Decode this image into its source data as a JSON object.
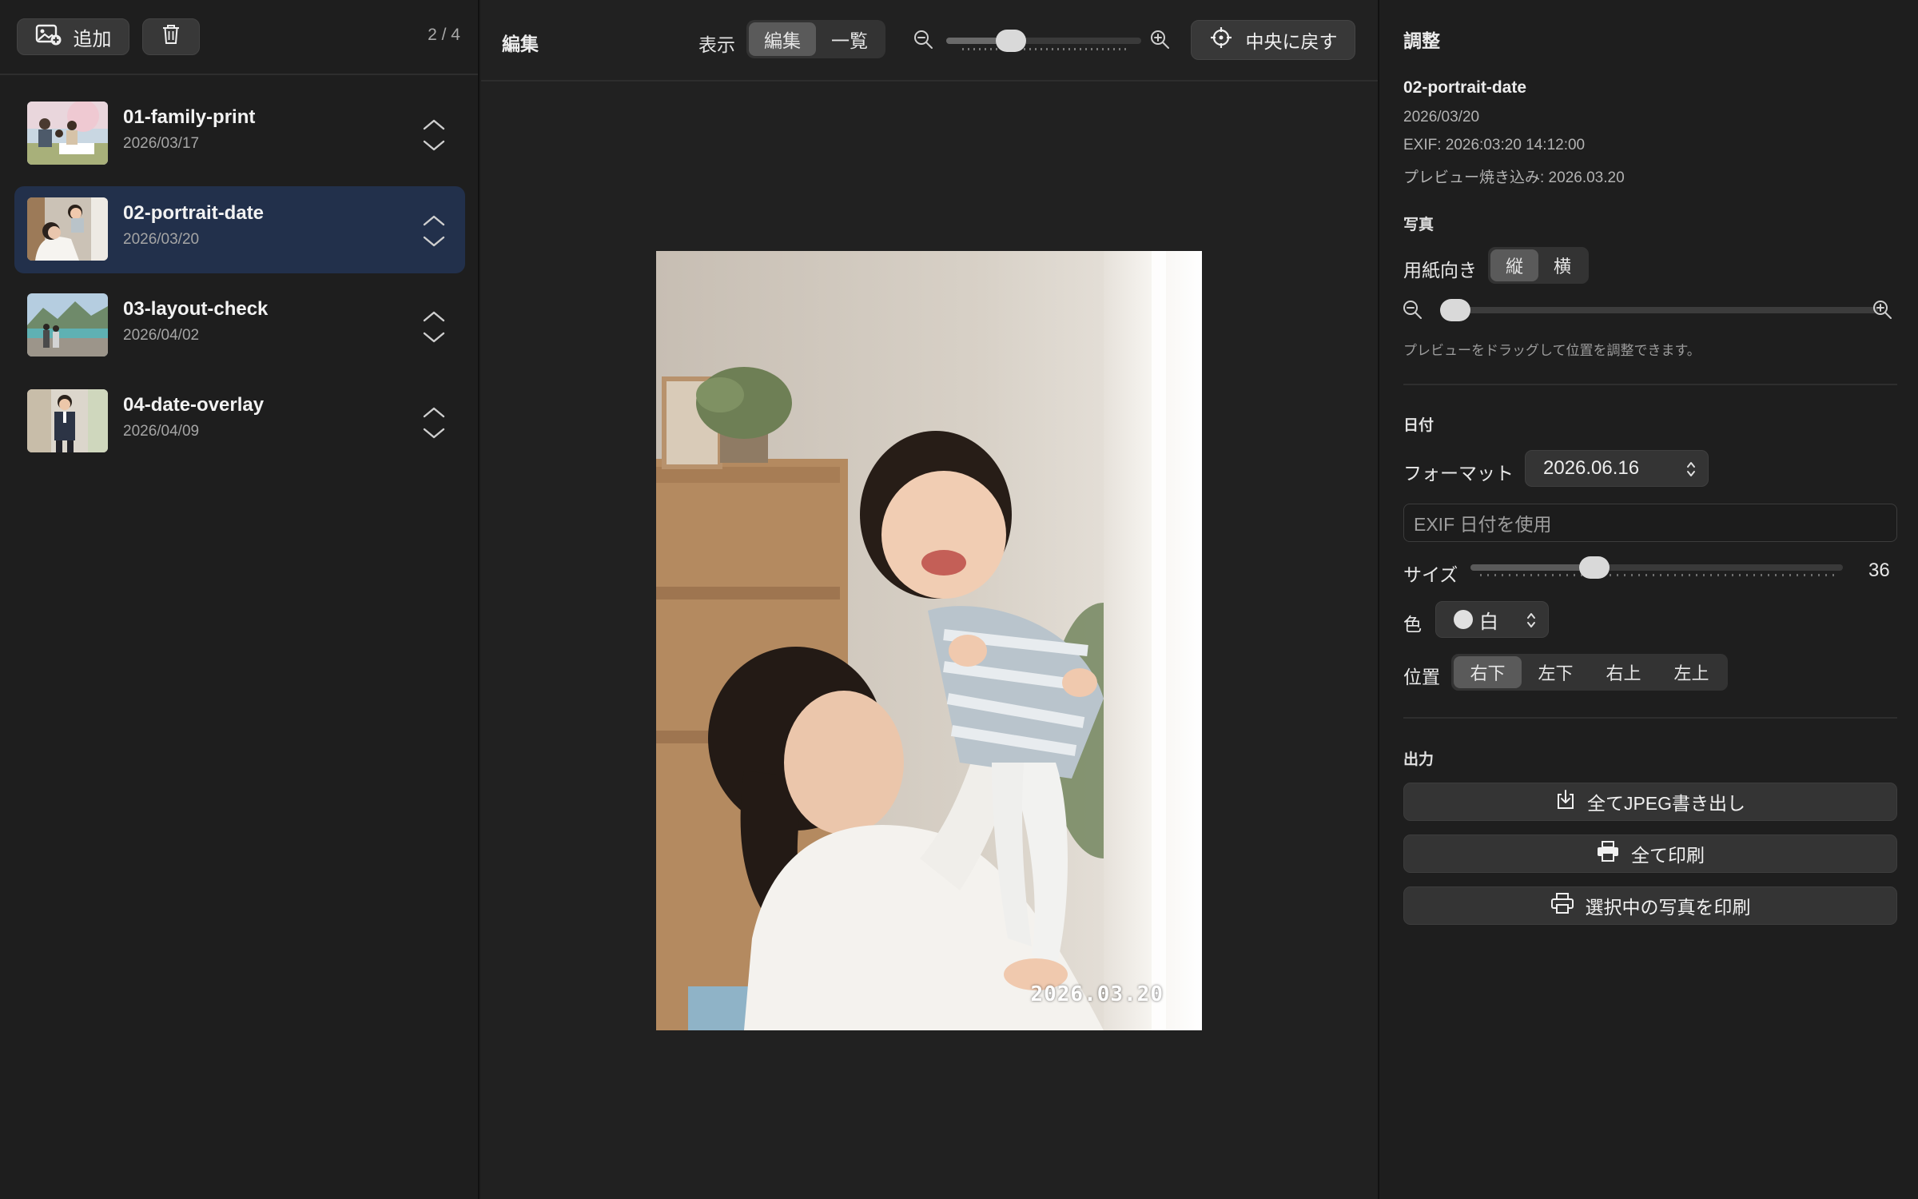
{
  "sidebar": {
    "add_label": "追加",
    "count": "2 / 4",
    "items": [
      {
        "name": "01-family-print",
        "date": "2026/03/17"
      },
      {
        "name": "02-portrait-date",
        "date": "2026/03/20"
      },
      {
        "name": "03-layout-check",
        "date": "2026/04/02"
      },
      {
        "name": "04-date-overlay",
        "date": "2026/04/09"
      }
    ]
  },
  "center": {
    "title": "編集",
    "view_label": "表示",
    "view_options": [
      "編集",
      "一覧"
    ],
    "view_selected": "編集",
    "zoom_level": 0.3,
    "recenter_label": "中央に戻す",
    "date_stamp": "2026.03.20"
  },
  "panel": {
    "title": "調整",
    "file_name": "02-portrait-date",
    "date": "2026/03/20",
    "exif": "EXIF: 2026:03:20 14:12:00",
    "preview_burn": "プレビュー焼き込み: 2026.03.20",
    "photo_section": "写真",
    "orientation_label": "用紙向き",
    "orientation_options": [
      "縦",
      "横"
    ],
    "orientation_selected": "縦",
    "photo_zoom": 0.0,
    "drag_hint": "プレビューをドラッグして位置を調整できます。",
    "date_section": "日付",
    "format_label": "フォーマット",
    "format_value": "2026.06.16",
    "exif_placeholder": "EXIF 日付を使用",
    "size_label": "サイズ",
    "size_value": "36",
    "color_label": "色",
    "color_value": "白",
    "color_swatch": "#e0e0e0",
    "position_label": "位置",
    "position_options": [
      "右下",
      "左下",
      "右上",
      "左上"
    ],
    "position_selected": "右下",
    "output_section": "出力",
    "export_jpeg": "全てJPEG書き出し",
    "print_all": "全て印刷",
    "print_selected": "選択中の写真を印刷"
  },
  "colors": {
    "selected_row": "#22304b",
    "background": "#1e1e1e"
  }
}
